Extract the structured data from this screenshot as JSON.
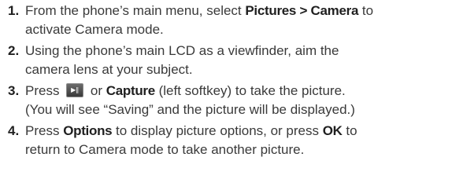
{
  "steps": [
    {
      "number": "1.",
      "line1_a": "From the phone’s main menu, select ",
      "line1_bold": "Pictures > Camera",
      "line1_b": " to",
      "line2": "activate Camera mode."
    },
    {
      "number": "2.",
      "line1": "Using the phone’s main LCD as a viewfinder, aim the",
      "line2": "camera lens at your subject."
    },
    {
      "number": "3.",
      "line1_a": "Press ",
      "key_icon_name": "capture-key-icon",
      "line1_b": " or ",
      "line1_bold": "Capture",
      "line1_c": " (left softkey) to take the picture.",
      "line2": "(You will see “Saving” and the picture will be displayed.)"
    },
    {
      "number": "4.",
      "line1_a": "Press ",
      "line1_bold1": "Options",
      "line1_b": " to display picture options, or press ",
      "line1_bold2": "OK",
      "line1_c": " to",
      "line2": "return to Camera mode to take another picture."
    }
  ]
}
